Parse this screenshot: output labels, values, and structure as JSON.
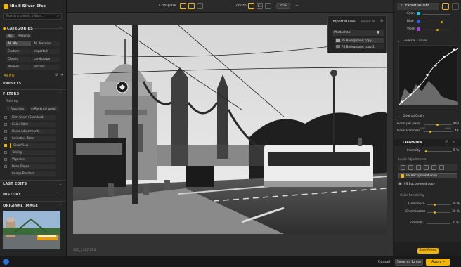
{
  "app": {
    "title": "Nik 8 Silver Efex"
  },
  "left": {
    "search_placeholder": "Search a preset, a filter...",
    "categories_title": "CATEGORIES",
    "cat_tabs": [
      "Nik",
      "Personal"
    ],
    "categories": [
      [
        "All Nik",
        "All Personal"
      ],
      [
        "Custom",
        "Imported"
      ],
      [
        "Classic",
        "Landscape"
      ],
      [
        "Modern",
        "Portrait"
      ]
    ],
    "collection_label": "All Nik",
    "presets_title": "PRESETS",
    "filters_title": "FILTERS",
    "filter_by": "Filter by:",
    "favorites": "Favorites",
    "recently_used": "Recently used",
    "filter_items": [
      "Film Grain (Standard)",
      "Color Filter",
      "Basic Adjustments",
      "Selective Toner",
      "ClearView",
      "Toning",
      "Vignette",
      "Burn Edges",
      "Image Borders"
    ],
    "last_edits": "LAST EDITS",
    "history": "HISTORY",
    "original_image": "ORIGINAL IMAGE"
  },
  "toolbar": {
    "compare": "Compare",
    "zoom": "Zoom",
    "zoom_value": "25%",
    "export_label": "Export as TIFF"
  },
  "masks": {
    "title": "Import Masks",
    "import_all": "Import All",
    "photoshop": "Photoshop",
    "layers": [
      "PS Background copy",
      "PS Background copy 2"
    ]
  },
  "status": {
    "filename": "SDC_1587.CR3"
  },
  "right": {
    "channels": [
      "Cyan",
      "Blue",
      "Violet"
    ],
    "levels_title": "Levels & Curves",
    "grain_title": "Original Grain",
    "grain_per_pixel": "Grain per pixel",
    "grain_per_pixel_val": "402",
    "grain_hardness": "Grain Hardness",
    "grain_hardness_val": "49",
    "grain_soft": "SOFT",
    "grain_hard": "HARD",
    "clearview_title": "ClearView",
    "intensity": "Intensity",
    "intensity_val": "5 %",
    "local_adj": "Local Adjustments",
    "ps_bg_copy": "PS Background copy",
    "ps_bg_copy2": "PS Background copy",
    "color_sensitivity": "Color Sensitivity",
    "luminance": "Luminance",
    "luminance_val": "30 %",
    "chrominance": "Chrominance",
    "chrominance_val": "30 %",
    "intensity2": "Intensity",
    "intensity2_val": "0 %",
    "save_preset": "Save Preset"
  },
  "bottom": {
    "cancel": "Cancel",
    "save_as_layer": "Save as Layer",
    "apply": "Apply"
  },
  "colors": {
    "accent": "#f2b600",
    "cyan": "#18c4d8",
    "blue": "#2f5ee0",
    "violet": "#a040d8"
  }
}
